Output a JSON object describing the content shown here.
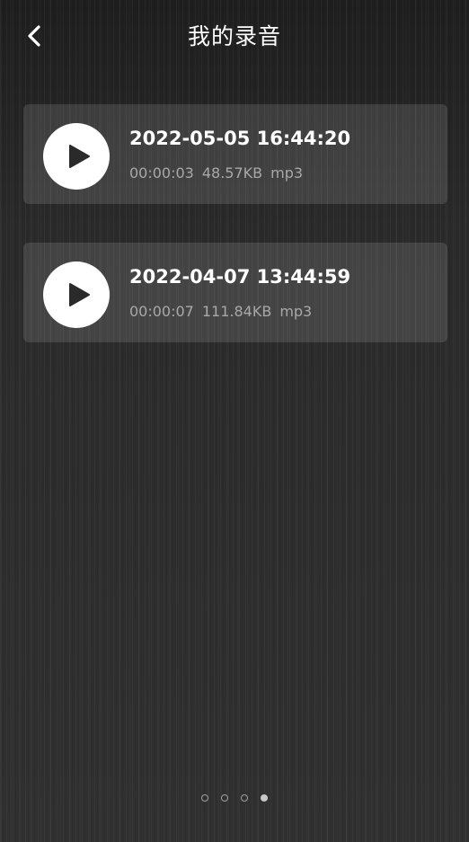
{
  "header": {
    "title": "我的录音",
    "back_icon": "chevron-left-icon"
  },
  "recordings": [
    {
      "title": "2022-05-05 16:44:20",
      "duration": "00:00:03",
      "size": "48.57KB",
      "format": "mp3",
      "icon": "play-icon"
    },
    {
      "title": "2022-04-07 13:44:59",
      "duration": "00:00:07",
      "size": "111.84KB",
      "format": "mp3",
      "icon": "play-icon"
    }
  ],
  "pagination": {
    "count": 4,
    "active": 4
  },
  "colors": {
    "background": "#2c2c2c",
    "card": "#4a4a4a",
    "text_primary": "#ffffff",
    "text_secondary": "#a8a8a8",
    "play_button": "#ffffff",
    "play_icon": "#2a2a2a"
  }
}
